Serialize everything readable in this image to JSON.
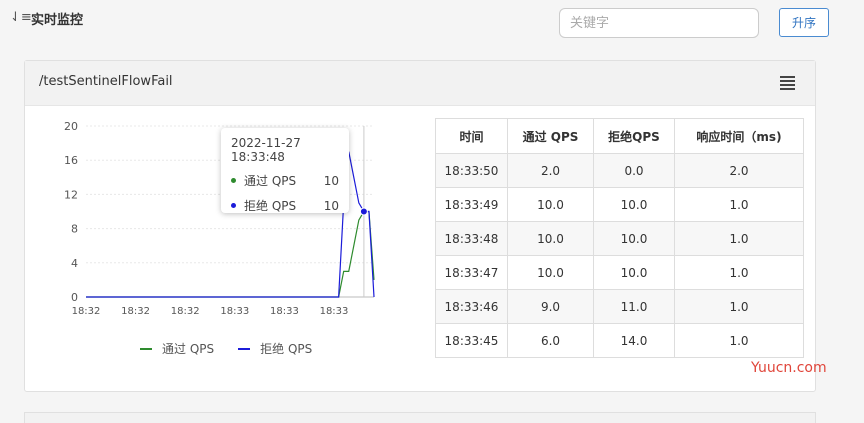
{
  "header": {
    "title": "实时监控",
    "sort_icon": "sort-descending-icon",
    "search_placeholder": "关键字",
    "sort_button_label": "升序"
  },
  "card": {
    "title": "/testSentinelFlowFail",
    "menu_icon": "hamburger-menu-icon"
  },
  "chart_data": {
    "type": "line",
    "y_ticks": [
      "20",
      "16",
      "12",
      "8",
      "4",
      "0"
    ],
    "x_ticks": [
      "18:32",
      "18:32",
      "18:32",
      "18:33",
      "18:33",
      "18:33"
    ],
    "ylim": [
      0,
      20
    ],
    "x": [
      0,
      1,
      2,
      3,
      4,
      5,
      6,
      7,
      8,
      9,
      10,
      11,
      12,
      13,
      14,
      15,
      16,
      17,
      18,
      19,
      20,
      21,
      22,
      23,
      24,
      25,
      26,
      27,
      28,
      29,
      30,
      31,
      32,
      33,
      34,
      35,
      36,
      37,
      38,
      39,
      40,
      41,
      42,
      43,
      44,
      45,
      46,
      47,
      48,
      49,
      50,
      51,
      52,
      53,
      54,
      55,
      56,
      57
    ],
    "series": [
      {
        "name": "通过 QPS",
        "color": "#2e8b2e",
        "values": [
          0,
          0,
          0,
          0,
          0,
          0,
          0,
          0,
          0,
          0,
          0,
          0,
          0,
          0,
          0,
          0,
          0,
          0,
          0,
          0,
          0,
          0,
          0,
          0,
          0,
          0,
          0,
          0,
          0,
          0,
          0,
          0,
          0,
          0,
          0,
          0,
          0,
          0,
          0,
          0,
          0,
          0,
          0,
          0,
          0,
          0,
          0,
          0,
          0,
          0,
          0,
          3,
          3,
          6,
          9,
          10,
          10,
          2
        ]
      },
      {
        "name": "拒绝 QPS",
        "color": "#1c1cd9",
        "values": [
          0,
          0,
          0,
          0,
          0,
          0,
          0,
          0,
          0,
          0,
          0,
          0,
          0,
          0,
          0,
          0,
          0,
          0,
          0,
          0,
          0,
          0,
          0,
          0,
          0,
          0,
          0,
          0,
          0,
          0,
          0,
          0,
          0,
          0,
          0,
          0,
          0,
          0,
          0,
          0,
          0,
          0,
          0,
          0,
          0,
          0,
          0,
          0,
          0,
          0,
          0,
          11,
          17,
          14,
          11,
          10,
          10,
          0
        ]
      }
    ],
    "grid": true,
    "legend_position": "bottom"
  },
  "tooltip": {
    "time": "2022-11-27 18:33:48",
    "rows": [
      {
        "name": "通过 QPS",
        "value": "10",
        "color": "#2e8b2e"
      },
      {
        "name": "拒绝 QPS",
        "value": "10",
        "color": "#1c1cd9"
      }
    ]
  },
  "table": {
    "headers": [
      "时间",
      "通过 QPS",
      "拒绝QPS",
      "响应时间（ms)"
    ],
    "rows": [
      [
        "18:33:50",
        "2.0",
        "0.0",
        "2.0"
      ],
      [
        "18:33:49",
        "10.0",
        "10.0",
        "1.0"
      ],
      [
        "18:33:48",
        "10.0",
        "10.0",
        "1.0"
      ],
      [
        "18:33:47",
        "10.0",
        "10.0",
        "1.0"
      ],
      [
        "18:33:46",
        "9.0",
        "11.0",
        "1.0"
      ],
      [
        "18:33:45",
        "6.0",
        "14.0",
        "1.0"
      ]
    ]
  },
  "watermark": "Yuucn.com"
}
